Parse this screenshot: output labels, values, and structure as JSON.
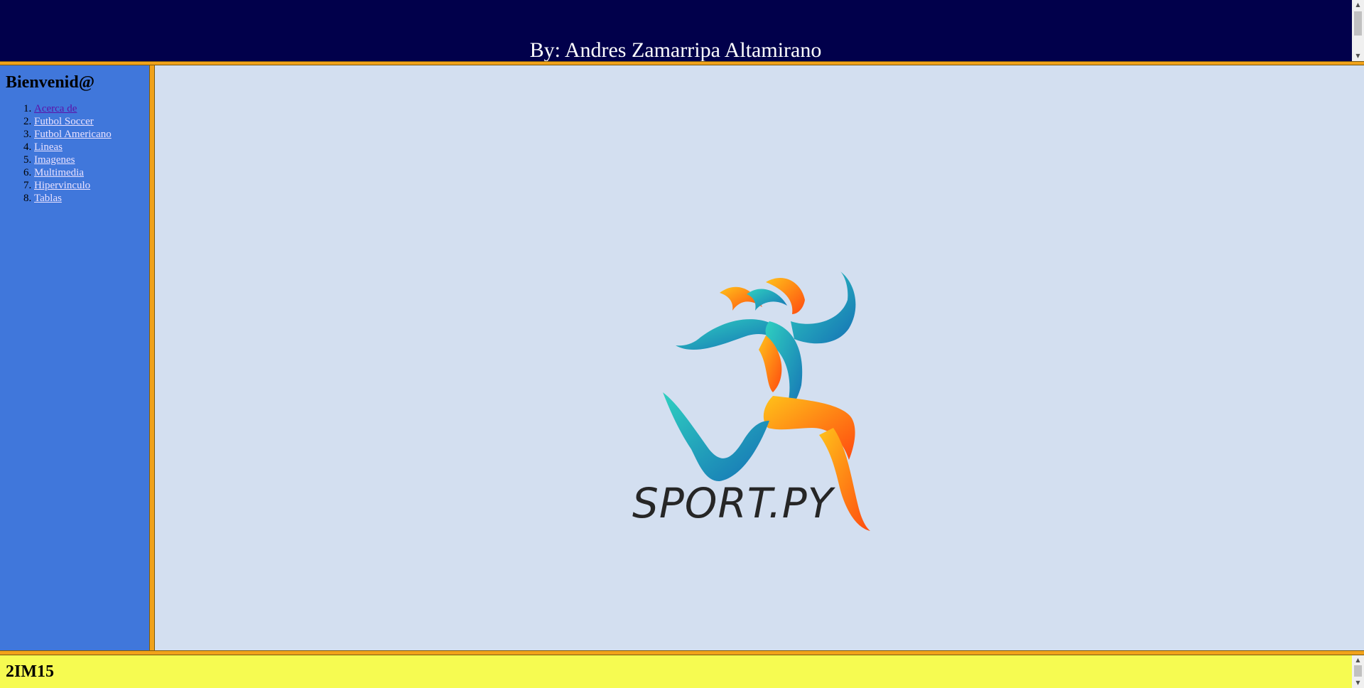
{
  "header": {
    "title": "By: Andres Zamarripa Altamirano"
  },
  "sidebar": {
    "heading": "Bienvenid@",
    "items": [
      {
        "label": "Acerca de"
      },
      {
        "label": "Futbol Soccer"
      },
      {
        "label": "Futbol Americano"
      },
      {
        "label": "Lineas"
      },
      {
        "label": "Imagenes"
      },
      {
        "label": "Multimedia"
      },
      {
        "label": "Hipervinculo"
      },
      {
        "label": "Tablas"
      }
    ]
  },
  "main": {
    "logo_text": "SPORT.PY"
  },
  "footer": {
    "text": "2IM15"
  },
  "colors": {
    "header_bg": "#01004b",
    "sidebar_bg": "#4077db",
    "main_bg": "#d3dff0",
    "border": "#f1a21a",
    "footer_bg": "#f6fb51"
  }
}
